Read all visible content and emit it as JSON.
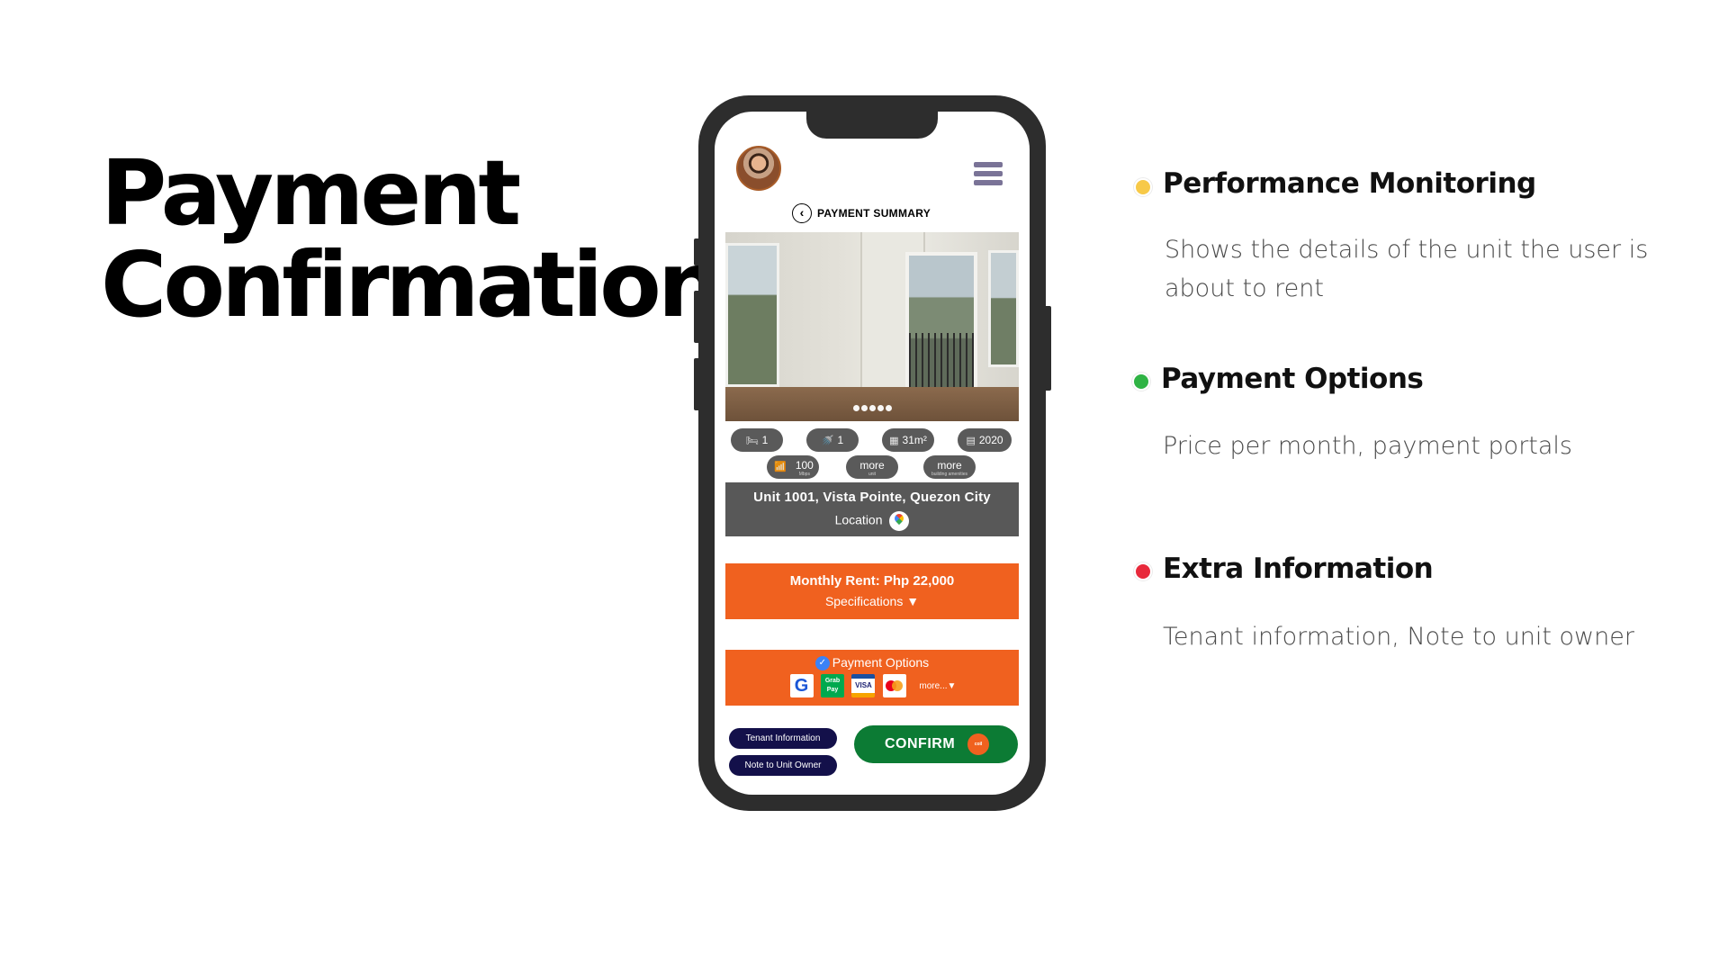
{
  "slide": {
    "title_line1": "Payment",
    "title_line2": "Confirmation"
  },
  "phone": {
    "header": {
      "title": "PAYMENT SUMMARY"
    },
    "photo": {
      "dots": 5
    },
    "features": [
      {
        "icon": "bed-icon",
        "label": "1"
      },
      {
        "icon": "bath-icon",
        "label": "1"
      },
      {
        "icon": "area-icon",
        "label": "31m²"
      },
      {
        "icon": "calendar-icon",
        "label": "2020"
      },
      {
        "icon": "wifi-icon",
        "label": "100",
        "sub": "Mbps"
      },
      {
        "icon": "",
        "label": "more",
        "sub": "unit"
      },
      {
        "icon": "",
        "label": "more",
        "sub": "building amenities"
      }
    ],
    "address": {
      "text": "Unit 1001, Vista Pointe, Quezon City",
      "location_label": "Location"
    },
    "rent": {
      "text": "Monthly Rent: Php 22,000",
      "specs_label": "Specifications ▼"
    },
    "payment": {
      "title": "Payment Options",
      "logos": [
        {
          "icon": "gcash-icon",
          "text": "G"
        },
        {
          "icon": "grabpay-icon",
          "text": "Grab Pay"
        },
        {
          "icon": "visa-icon",
          "text": "VISA"
        },
        {
          "icon": "mastercard-icon",
          "text": ""
        }
      ],
      "more_label": "more...▼"
    },
    "buttons": {
      "tenant_info": "Tenant Information",
      "note_owner": "Note to Unit Owner",
      "confirm": "CONFIRM",
      "coin": "coil"
    }
  },
  "info_items": [
    {
      "color": "#f7c948",
      "heading": "Performance Monitoring",
      "body": "Shows the details of the unit the user is about to rent"
    },
    {
      "color": "#2fb344",
      "heading": "Payment Options",
      "body": "Price per month, payment portals"
    },
    {
      "color": "#e8293b",
      "heading": "Extra Information",
      "body": "Tenant information, Note to unit owner"
    }
  ]
}
